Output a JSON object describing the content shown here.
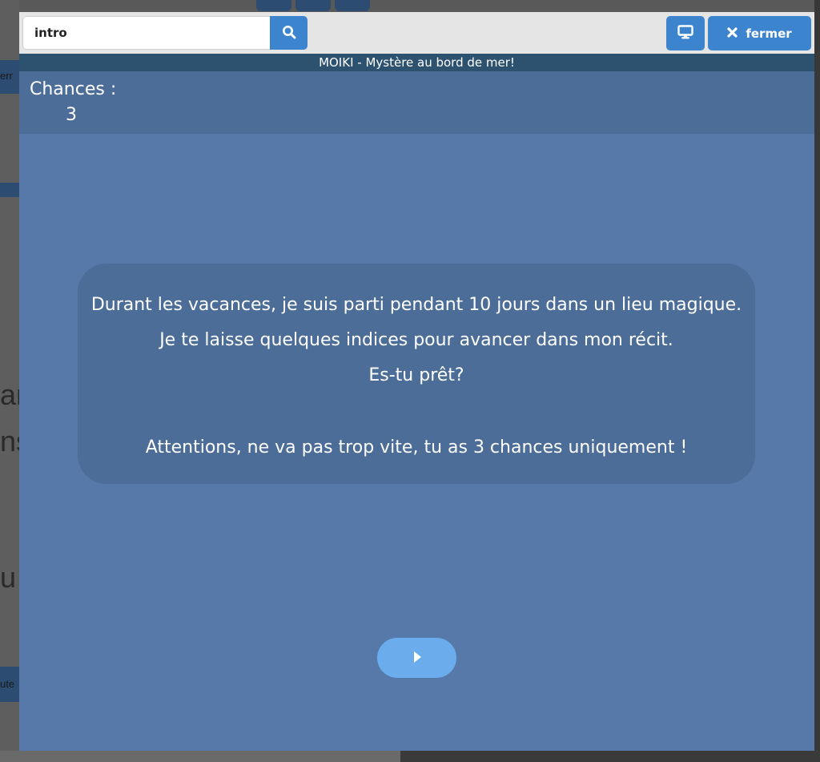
{
  "toolbar": {
    "search_value": "intro",
    "search_icon": "search-icon",
    "screen_icon": "monitor-icon",
    "close_icon": "close-x-icon",
    "close_label": "fermer"
  },
  "title": "MOIKI - Mystère au bord de mer!",
  "chances": {
    "label": "Chances :",
    "count": "3"
  },
  "story": {
    "lines": [
      "Durant les vacances, je suis parti pendant 10 jours dans un lieu magique.",
      "Je te laisse quelques indices pour avancer dans mon récit.",
      "Es-tu prêt?",
      "Attentions, ne va pas trop vite, tu as 3 chances uniquement !"
    ]
  },
  "next_button": {
    "icon": "play-icon"
  },
  "colors": {
    "accent": "#3d84cf",
    "modal_bg": "#5679a9",
    "panel_bg": "#4c6d98",
    "title_bar": "#2d5270",
    "next_button": "#6aacec"
  },
  "background_app": {
    "fragments": [
      "an",
      "ns",
      "u"
    ],
    "button_fragments": [
      "err",
      "ute"
    ]
  }
}
